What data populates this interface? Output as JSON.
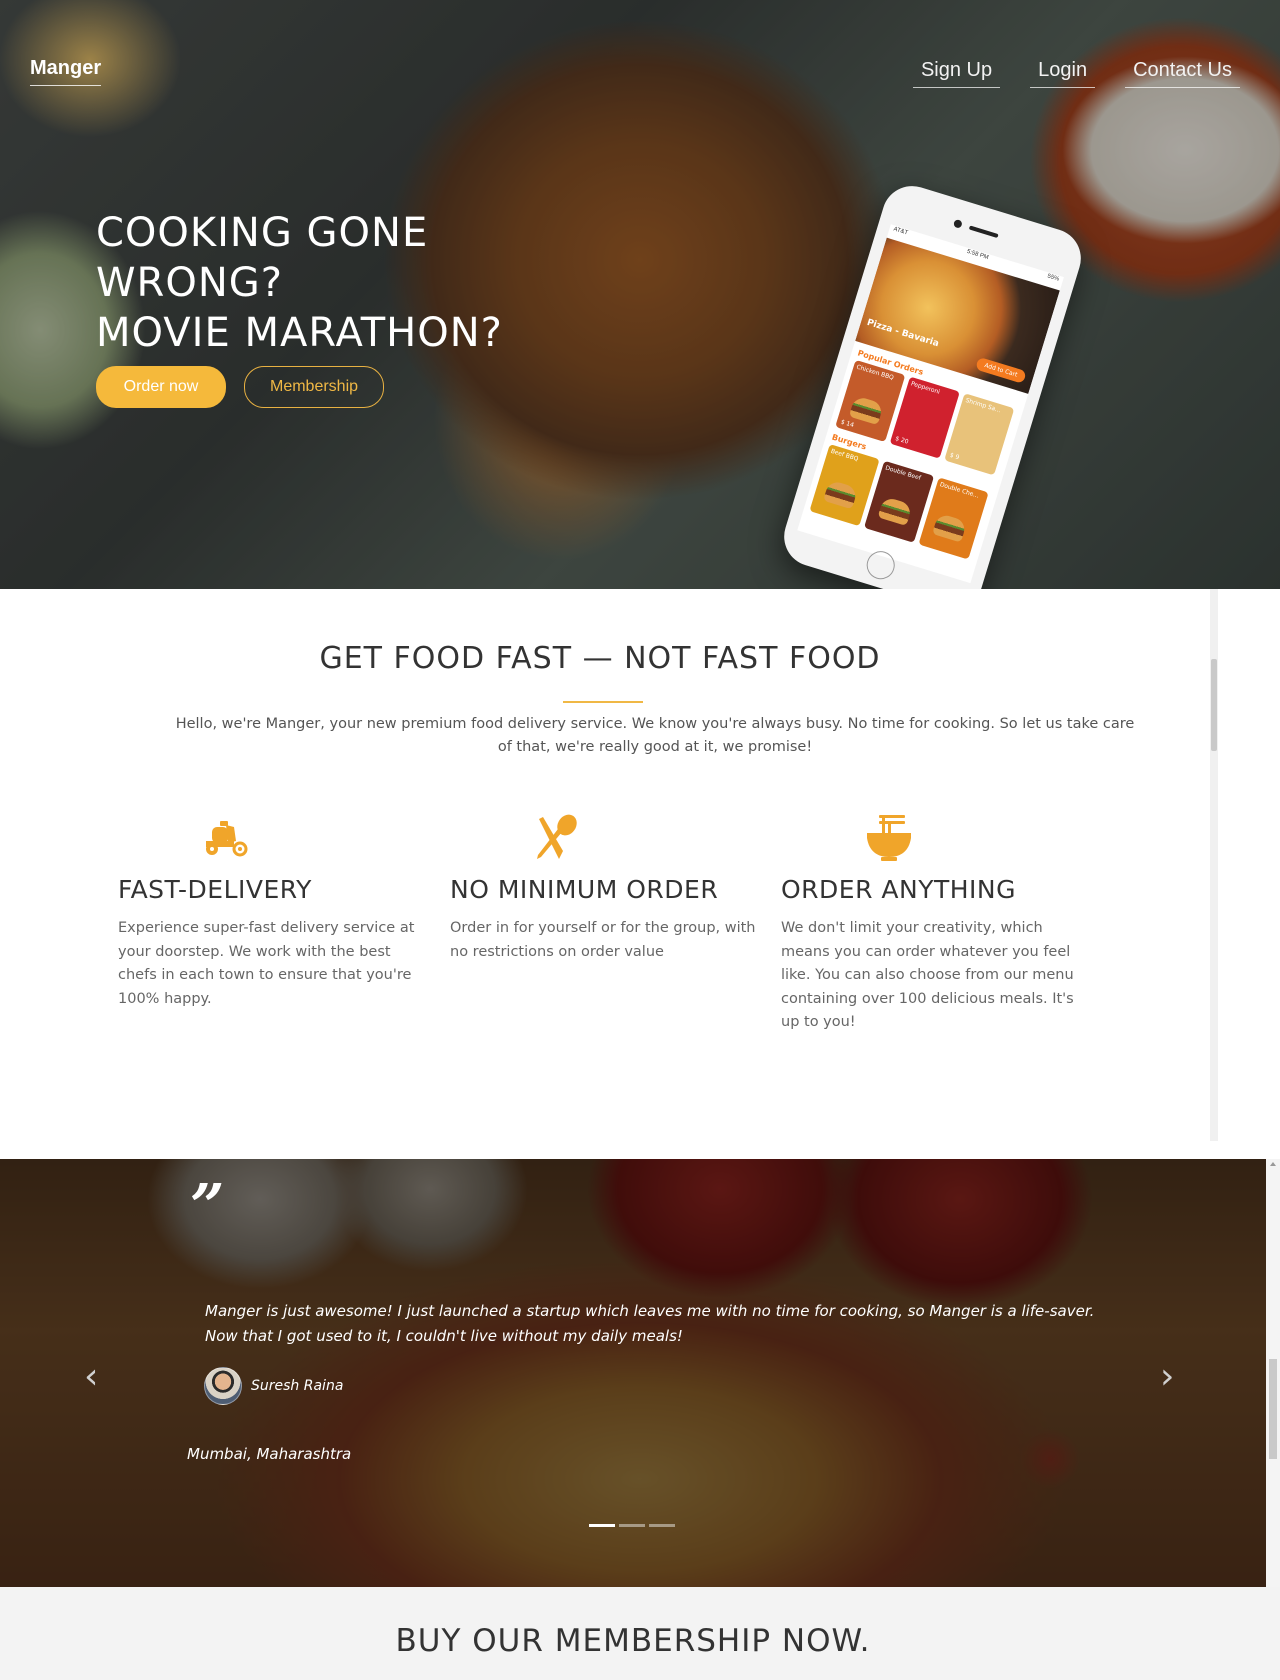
{
  "header": {
    "brand": "Manger",
    "nav": [
      "Sign Up",
      "Login",
      "Contact Us"
    ]
  },
  "hero": {
    "headline_lines": [
      "COOKING GONE",
      "WRONG?",
      "MOVIE MARATHON?"
    ],
    "primary_cta": "Order now",
    "secondary_cta": "Membership",
    "phone": {
      "carrier": "AT&T",
      "time": "5:58 PM",
      "battery": "55%",
      "featured": "Pizza - Bavaria",
      "add_to_cart": "Add to Cart",
      "section1": "Popular Orders",
      "section2": "Burgers",
      "cards_row1": [
        {
          "name": "Chicken BBQ",
          "price": "$ 14"
        },
        {
          "name": "Pepperoni",
          "price": "$ 20"
        },
        {
          "name": "Shrimp Sa...",
          "price": "$ 9"
        }
      ],
      "cards_row2": [
        {
          "name": "Beef BBQ",
          "price": ""
        },
        {
          "name": "Double Beef",
          "price": ""
        },
        {
          "name": "Double Che...",
          "price": ""
        }
      ]
    }
  },
  "features": {
    "heading": "GET FOOD FAST — NOT FAST FOOD",
    "intro": "Hello, we're Manger, your new premium food delivery service. We know you're always busy. No time for cooking. So let us take care of that, we're really good at it, we promise!",
    "items": [
      {
        "icon": "scooter-icon",
        "title": "FAST-DELIVERY",
        "text": "Experience super-fast delivery service at your doorstep. We work with the best chefs in each town to ensure that you're 100% happy."
      },
      {
        "icon": "utensils-icon",
        "title": "NO MINIMUM ORDER",
        "text": "Order in for yourself or for the group, with no restrictions on order value"
      },
      {
        "icon": "noodle-bowl-icon",
        "title": "ORDER ANYTHING",
        "text": "We don't limit your creativity, which means you can order whatever you feel like. You can also choose from our menu containing over 100 delicious meals. It's up to you!"
      }
    ],
    "accent_color": "#f0b845"
  },
  "testimonial": {
    "quote_mark": "”",
    "quote": "Manger is just awesome! I just launched a startup which leaves me with no time for cooking, so Manger is a life-saver. Now that I got used to it, I couldn't live without my daily meals!",
    "author": "Suresh Raina",
    "location": "Mumbai, Maharashtra",
    "prev_arrow": "‹",
    "next_arrow": "›",
    "slide_count": 3,
    "active_slide": 1
  },
  "membership": {
    "heading": "BUY OUR MEMBERSHIP NOW."
  },
  "colors": {
    "accent": "#f5b93b",
    "text_dark": "#333333"
  }
}
